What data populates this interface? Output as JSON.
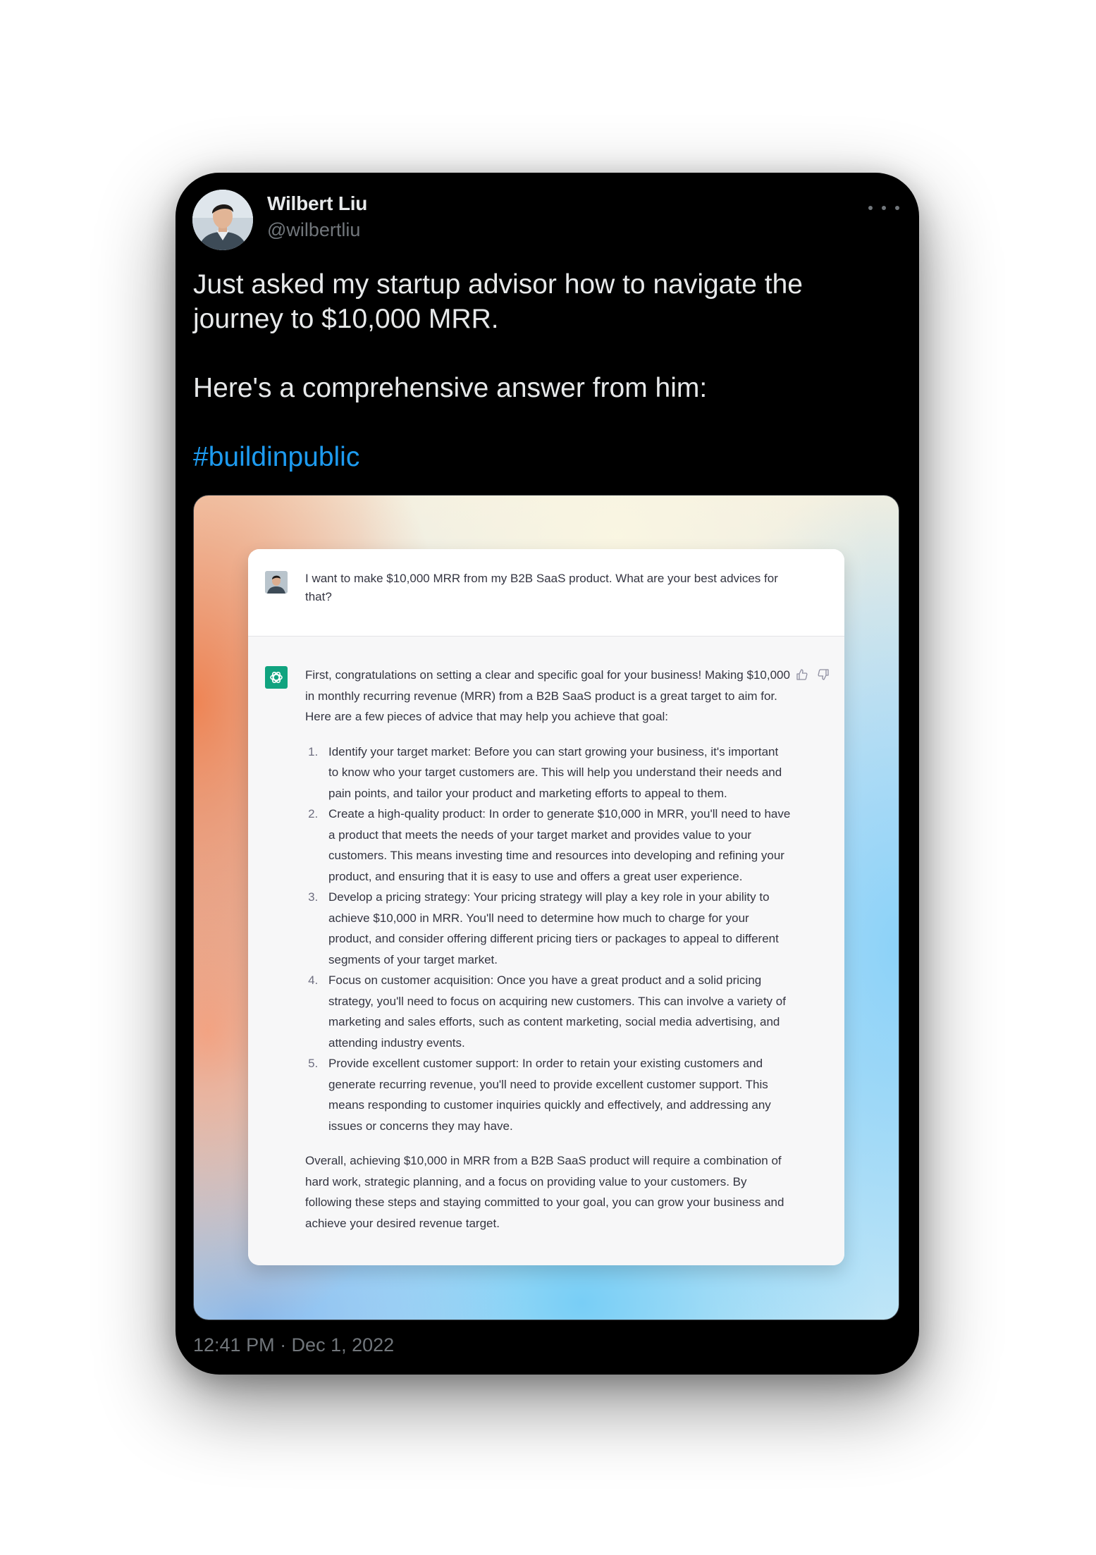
{
  "tweet": {
    "author_name": "Wilbert Liu",
    "author_handle": "@wilbertliu",
    "more_icon": "more-horizontal-icon",
    "text_line1": "Just asked my startup advisor how to navigate the journey to $10,000 MRR.",
    "text_line2": "Here's a comprehensive answer from him:",
    "hashtag": "#buildinpublic",
    "timestamp": "12:41 PM · Dec 1, 2022"
  },
  "chat": {
    "user_message": "I want to make $10,000 MRR from my B2B SaaS product. What are your best advices for that?",
    "assistant_icon": "openai-logo-icon",
    "feedback_icons": [
      "thumbs-up-icon",
      "thumbs-down-icon"
    ],
    "intro": "First, congratulations on setting a clear and specific goal for your business! Making $10,000 in monthly recurring revenue (MRR) from a B2B SaaS product is a great target to aim for. Here are a few pieces of advice that may help you achieve that goal:",
    "items": [
      "Identify your target market: Before you can start growing your business, it's important to know who your target customers are. This will help you understand their needs and pain points, and tailor your product and marketing efforts to appeal to them.",
      "Create a high-quality product: In order to generate $10,000 in MRR, you'll need to have a product that meets the needs of your target market and provides value to your customers. This means investing time and resources into developing and refining your product, and ensuring that it is easy to use and offers a great user experience.",
      "Develop a pricing strategy: Your pricing strategy will play a key role in your ability to achieve $10,000 in MRR. You'll need to determine how much to charge for your product, and consider offering different pricing tiers or packages to appeal to different segments of your target market.",
      "Focus on customer acquisition: Once you have a great product and a solid pricing strategy, you'll need to focus on acquiring new customers. This can involve a variety of marketing and sales efforts, such as content marketing, social media advertising, and attending industry events.",
      "Provide excellent customer support: In order to retain your existing customers and generate recurring revenue, you'll need to provide excellent customer support. This means responding to customer inquiries quickly and effectively, and addressing any issues or concerns they may have."
    ],
    "conclusion": "Overall, achieving $10,000 in MRR from a B2B SaaS product will require a combination of hard work, strategic planning, and a focus on providing value to your customers. By following these steps and staying committed to your goal, you can grow your business and achieve your desired revenue target."
  }
}
